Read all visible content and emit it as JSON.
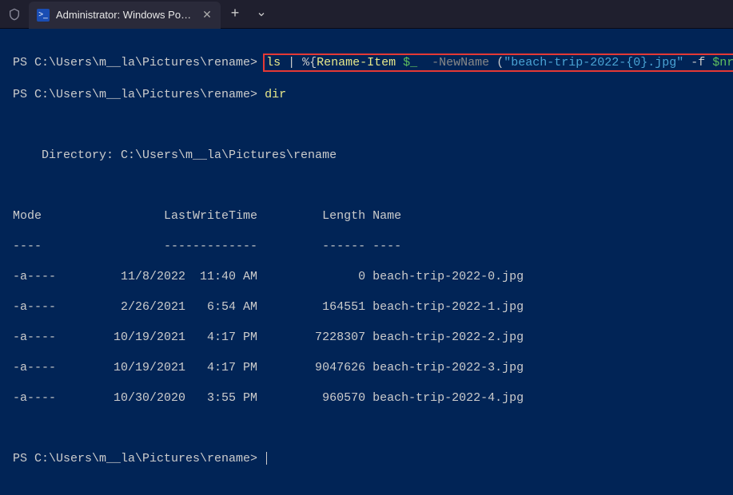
{
  "titlebar": {
    "tab_title": "Administrator: Windows Powe",
    "close_glyph": "✕",
    "new_tab_glyph": "+",
    "dropdown_glyph": "⌄",
    "ps_icon_glyph": ">_"
  },
  "terminal": {
    "prompt1": "PS C:\\Users\\m__la\\Pictures\\rename> ",
    "cmd": {
      "ls": "ls",
      "pipe": " | ",
      "pct": "%{",
      "rename": "Rename-Item ",
      "var": "$_",
      "newname": "  -NewName ",
      "paren": "(",
      "str": "\"beach-trip-2022-{0}.jpg\"",
      "dashf": " -f ",
      "nr": "$nr"
    },
    "prompt2": "PS C:\\Users\\m__la\\Pictures\\rename> ",
    "dir_cmd": "dir",
    "blank": "",
    "dir_header": "    Directory: C:\\Users\\m__la\\Pictures\\rename",
    "col_header": "Mode                 LastWriteTime         Length Name",
    "col_divider": "----                 -------------         ------ ----",
    "rows": [
      "-a----         11/8/2022  11:40 AM              0 beach-trip-2022-0.jpg",
      "-a----         2/26/2021   6:54 AM         164551 beach-trip-2022-1.jpg",
      "-a----        10/19/2021   4:17 PM        7228307 beach-trip-2022-2.jpg",
      "-a----        10/19/2021   4:17 PM        9047626 beach-trip-2022-3.jpg",
      "-a----        10/30/2020   3:55 PM         960570 beach-trip-2022-4.jpg"
    ],
    "prompt3": "PS C:\\Users\\m__la\\Pictures\\rename> "
  }
}
